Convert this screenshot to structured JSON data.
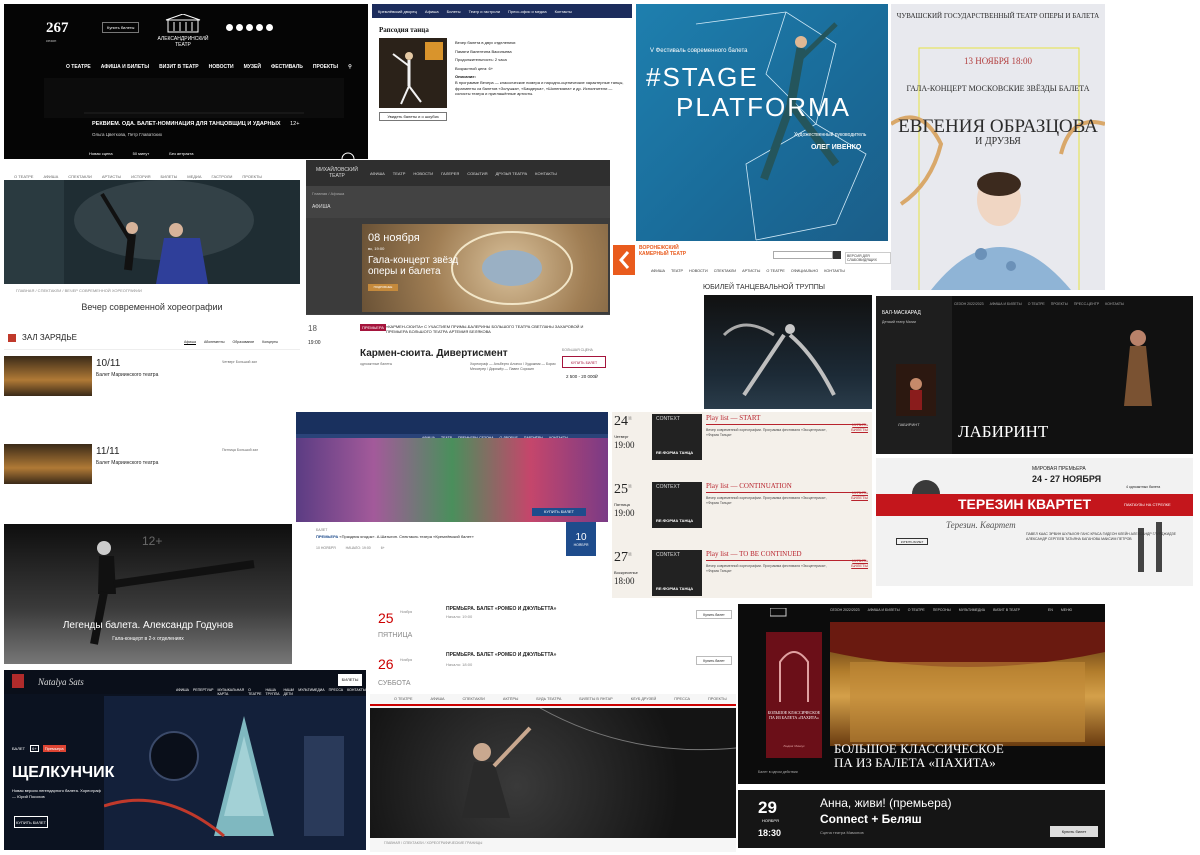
{
  "alexandrinsky": {
    "season": "267",
    "season_sub": "сезон",
    "tickets_btn": "Купить билеты",
    "logo_name": "АЛЕКСАНДРИНСКИЙ ТЕАТР",
    "nav": [
      "О ТЕАТРЕ",
      "АФИША И БИЛЕТЫ",
      "ВИЗИТ В ТЕАТР",
      "НОВОСТИ",
      "МУЗЕЙ",
      "ФЕСТИВАЛЬ",
      "ПРОЕКТЫ"
    ],
    "headline": "РЕКВИЕМ. ОДА. БАЛЕТ-НОМИНАЦИЯ ДЛЯ ТАНЦОВЩИЦ И УДАРНЫХ",
    "age": "12+",
    "names": "Ольга Цветкова, Петр Главатских",
    "meta": [
      "Новая сцена",
      "50 минут",
      "Без антракта"
    ]
  },
  "kremlin_page": {
    "nav": [
      "Кремлёвский дворец",
      "Афиша",
      "Билеты",
      "Театр и гастроли",
      "Пресс-офис и медиа",
      "Контакты"
    ],
    "title": "Рапсодия танца",
    "btn": "Увидеть балеты и о шоубиз",
    "info": [
      "Вечер балета в двух отделениях",
      "Памяти Валентина Васильева",
      "Продолжительность: 2 часа",
      "Возрастной ценз: 6+",
      "Описание:",
      "В программе Вечера — классические номера и народно-сценические характерные танцы, фрагменты из балетов «Золушка», «Баядерка», «Шопениана» и др. Исполнители — солисты театра и приглашённые артисты."
    ]
  },
  "stage_platforma": {
    "fest": "V Фестиваль современного балета",
    "line1": "#STAGE",
    "line2": "PLATFORMA",
    "art_label": "Художественный руководитель",
    "name": "ОЛЕГ ИВЕНКО"
  },
  "chuvash": {
    "header": "ЧУВАШСКИЙ ГОСУДАРСТВЕННЫЙ ТЕАТР ОПЕРЫ И БАЛЕТА",
    "date": "13 НОЯБРЯ 18:00",
    "gala": "ГАЛА-КОНЦЕРТ МОСКОВСКИЕ ЗВЁЗДЫ БАЛЕТА",
    "star": "ЕВГЕНИЯ ОБРАЗЦОВА",
    "friends": "И ДРУЗЬЯ"
  },
  "contemporary": {
    "nav": [
      "О ТЕАТРЕ",
      "АФИША",
      "СПЕКТАКЛИ",
      "АРТИСТЫ",
      "ИСТОРИЯ",
      "БИЛЕТЫ",
      "МЕДИА",
      "ГАСТРОЛИ",
      "ПРОЕКТЫ"
    ],
    "crumb": "ГЛАВНАЯ / СПЕКТАКЛИ / ВЕЧЕР СОВРЕМЕННОЙ ХОРЕОГРАФИИ",
    "title": "Вечер современной хореографии"
  },
  "mikhailovsky": {
    "logo": "МИХАЙЛОВСКИЙ ТЕАТР",
    "nav": [
      "АФИША",
      "ТЕАТР",
      "НОВОСТИ",
      "ГАЛЕРЕЯ",
      "СОБЫТИЯ",
      "ДРУЗЬЯ ТЕАТРА",
      "КОНТАКТЫ"
    ],
    "crumb": "Главная / Афиша",
    "afisha": "АФИША",
    "date": "08 ноября",
    "dsub": "вс, 19:00",
    "title": "Гала-концерт звёзд оперы и балета",
    "more": "ПОДРОБНЕЕ"
  },
  "voronezh": {
    "name": "ВОРОНЕЖСКИЙ КАМЕРНЫЙ ТЕАТР",
    "ver": "ВЕРСИЯ ДЛЯ СЛАБОВИДЯЩИХ",
    "nav": [
      "АФИША",
      "ТЕАТР",
      "НОВОСТИ",
      "СПЕКТАКЛИ",
      "АРТИСТЫ",
      "О ТЕАТРЕ",
      "ОФИЦИАЛЬНО",
      "КОНТАКТЫ"
    ],
    "title": "ЮБИЛЕЙ ТАНЦЕВАЛЬНОЙ ТРУППЫ"
  },
  "labyrinth": {
    "logo": "БАЛ-МАСКАРАД",
    "sub": "Детский театр Магии",
    "nav": [
      "СЕЗОН 2022/2023",
      "АФИША И БИЛЕТЫ",
      "О ТЕАТРЕ",
      "ПРОЕКТЫ",
      "ПРЕСС-ЦЕНТР",
      "КОНТАКТЫ"
    ],
    "mini": "ЛАБИРИНТ",
    "title": "ЛАБИРИНТ"
  },
  "zaryadye": {
    "logo": "ЗАЛ ЗАРЯДЬЕ",
    "tabs": [
      "Афиша",
      "Абонементы",
      "Образование",
      "Концерты"
    ],
    "rows": [
      {
        "date": "10/11",
        "event": "Балет Мариинского театра",
        "extra": "Четверг  Большой зал"
      },
      {
        "date": "11/11",
        "event": "Балет Мариинского театра",
        "extra": "Пятница  Большой зал"
      }
    ]
  },
  "carmen": {
    "date": "18",
    "time": "19:00",
    "badge": "ПРЕМЬЕРА",
    "cast": "«КАРМЕН-СЮИТА» С УЧАСТИЕМ ПРИМЫ-БАЛЕРИНЫ БОЛЬШОГО ТЕАТРА СВЕТЛАНЫ ЗАХАРОВОЙ И ПРЕМЬЕРА БОЛЬШОГО ТЕАТРА АРТЕМИЯ БЕЛЯКОВА",
    "title": "Кармен-сюита. Дивертисмент",
    "sub": "одноактные балеты",
    "creds": "Хореограф — Альберто Алонсо / Художник — Борис Мессерер / Дирижёр — Павел Сорокин",
    "btn": "КУПИТЬ БИЛЕТ",
    "price": "2 500 - 20 000₽",
    "stage": "БОЛЬШАЯ СЦЕНА"
  },
  "kremlin_ballet": {
    "nav": [
      "АФИША",
      "ТЕАТР",
      "ПРЕМЬЕРЫ СЕЗОНА",
      "О ДВОРЦЕ",
      "ПАРТНЁРЫ",
      "КОНТАКТЫ"
    ],
    "buy": "КУПИТЬ БИЛЕТ",
    "cal_num": "10",
    "cal_month": "НОЯБРЯ",
    "label": "БАЛЕТ",
    "premiere_bold": "ПРЕМЬЕРА",
    "premiere": "«Праздник ягодок». А.Шатыгин. Спектакль театра «Кремлёвский балет»",
    "meta": [
      "10 НОЯБРЯ",
      "НАЧАЛО: 19:00",
      "6+"
    ]
  },
  "playlist": {
    "rows": [
      {
        "day": "24",
        "mon": "11",
        "wd": "Четверг",
        "time": "19:00",
        "title": "Play list — START",
        "desc": "Вечер современной хореографии. Программа фестиваля «Эксцентрика», «Форма Танца»",
        "buy": "КУПИТЬ БИЛЕТЫ"
      },
      {
        "day": "25",
        "mon": "11",
        "wd": "Пятница",
        "time": "19:00",
        "title": "Play list — CONTINUATION",
        "desc": "Вечер современной хореографии. Программа фестиваля «Эксцентрика», «Форма Танца»",
        "buy": "КУПИТЬ БИЛЕТЫ"
      },
      {
        "day": "27",
        "mon": "11",
        "wd": "Воскресенье",
        "time": "18:00",
        "title": "Play list — TO BE CONTINUED",
        "desc": "Вечер современной хореографии. Программа фестиваля «Эксцентрика», «Форма Танца»",
        "buy": "КУПИТЬ БИЛЕТЫ"
      }
    ],
    "img_top": "CONTEXT",
    "img_bottom": "RE:ФОРМА ТАНЦА"
  },
  "terezin": {
    "prem": "МИРОВАЯ ПРЕМЬЕРА",
    "dates": "24 - 27 НОЯБРЯ",
    "perf": "4 одноактных балета",
    "title": "ТЕРЕЗИН КВАРТЕТ",
    "tag": "ПАКГАУЗЫ НА СТРЕЛКЕ",
    "script": "Терезин. Квартет",
    "btn": "КУПИТЬ БИЛЕТ",
    "names": "ПАВЕЛ КААС  ЭРВИН ШУЛЬХОФ  ГАНС КРАСА  ГИДЕОН КЛЕЙН  АЛЕКСАНДР ГЛУРДЖИДЗЕ  АЛЕКСАНДР СЕРГЕЕВ  ТАТЬЯНА БАГАНОВА  МАКСИМ ПЕТРОВ"
  },
  "godunov": {
    "age": "12+",
    "title": "Легенды балета. Александр Годунов",
    "sub": "Гала-концерт в 2-х отделениях"
  },
  "romeo": {
    "rows": [
      {
        "day": "25",
        "month": "Ноября",
        "wd": "ПЯТНИЦА",
        "title": "ПРЕМЬЕРА. БАЛЕТ «РОМЕО И ДЖУЛЬЕТТА»",
        "start": "Начало: 19:00",
        "btn": "Купить билет"
      },
      {
        "day": "26",
        "month": "Ноября",
        "wd": "СУББОТА",
        "title": "ПРЕМЬЕРА. БАЛЕТ «РОМЕО И ДЖУЛЬЕТТА»",
        "start": "Начало: 18:00",
        "btn": "Купить билет"
      }
    ]
  },
  "dark_stage": {
    "nav": [
      "О ТЕАТРЕ",
      "АФИША",
      "СПЕКТАКЛИ",
      "АКТЁРЫ",
      "БУДЬ ТЕАТРА",
      "БИЛЕТЫ В ЯНТАР",
      "КЛУБ ДРУЗЕЙ",
      "ПРЕССА",
      "ПРОЕКТЫ"
    ],
    "crumb": "ГЛАВНАЯ / СПЕКТАКЛИ / ХОРЕОГРАФИЧЕСКИЕ ГРАНИЦЫ"
  },
  "nutcracker": {
    "nav": [
      "АФИША",
      "РЕПЕРТУАР",
      "МУЗЫКАЛЬНАЯ КАРТА",
      "О ТЕАТРЕ",
      "НАША ТРУППА",
      "НАШИ ДЕТИ",
      "МУЛЬТИМЕДИА",
      "ПРЕССА",
      "КОНТАКТЫ"
    ],
    "tix": "БИЛЕТЫ",
    "label": "БАЛЕТ",
    "age": "6+",
    "prem": "Премьера",
    "title": "ЩЕЛКУНЧИК",
    "sub": "Новая версия легендарного балета. Хореограф — Юрий Посохов",
    "buy": "КУПИТЬ БИЛЕТ"
  },
  "bolshoi": {
    "nav": [
      "СЕЗОН 2022/2023",
      "АФИША И БИЛЕТЫ",
      "О ТЕАТРЕ",
      "ПЕРСОНЫ",
      "МУЛЬТИМЕДИА",
      "ВИЗИТ В ТЕАТР",
      "EN",
      "МЕНЮ"
    ],
    "poster": "БОЛЬШОЕ КЛАССИЧЕСКОЕ ПА ИЗ БАЛЕТА «ПАХИТА»",
    "poster_sub": "Людвиг Минкус",
    "title1": "БОЛЬШОЕ КЛАССИЧЕСКОЕ",
    "title2": "ПА ИЗ БАЛЕТА «ПАХИТА»",
    "foot": "Балет в одном действии"
  },
  "anna": {
    "day": "29",
    "month": "НОЯБРЯ",
    "time": "18:30",
    "title": "Анна, живи! (премьера)",
    "title2": "Connect + Беляш",
    "stage": "Сцена театра Мамонов",
    "buy": "Купить билет"
  },
  "colors": {
    "red": "#c4161c",
    "kremlin_blue": "#1e4c8c",
    "stage_blue": "#1e7fae",
    "voronezh_orange": "#e95b1d"
  }
}
